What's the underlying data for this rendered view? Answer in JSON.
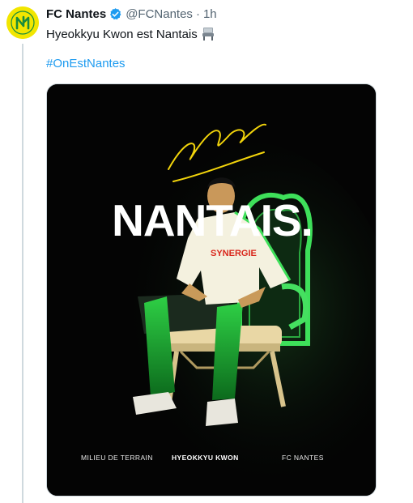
{
  "account": {
    "name": "FC Nantes",
    "handle": "@FCNantes",
    "separator": "·",
    "time": "1h",
    "avatar_icon": "fc-nantes-crest-icon",
    "verified_icon": "verified-badge-icon"
  },
  "tweet": {
    "text": "Hyeokkyu Kwon est Nantais",
    "text_icon": "chair-emoji-icon",
    "hashtag": "#OnEstNantes"
  },
  "media": {
    "headline": "NANTAIS.",
    "jersey_text": "SYNERGIE",
    "captions": {
      "position": "MILIEU DE TERRAIN",
      "player": "HYEOKKYU KWON",
      "club": "FC NANTES"
    },
    "colors": {
      "background": "#040404",
      "jersey": "#f4f1df",
      "accent_green": "#33d64a",
      "signature_yellow": "#f2d40b"
    }
  },
  "colors": {
    "link": "#1d9bf0",
    "verified": "#1d9bf0",
    "secondary_text": "#536471",
    "avatar_bg": "#f2e600"
  }
}
